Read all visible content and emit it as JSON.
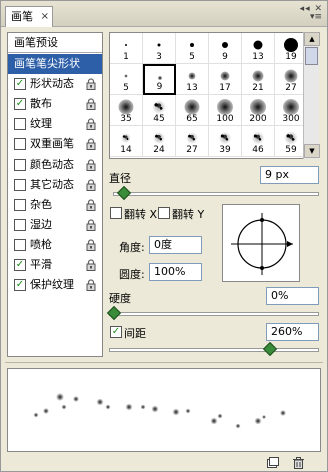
{
  "window": {
    "tab_title": "画笔",
    "tab_close": "×",
    "window_buttons": "◂◂ ✕",
    "menu_glyph": "▾≡"
  },
  "sidebar": {
    "header": "画笔预设",
    "items": [
      {
        "label": "画笔笔尖形状",
        "selected": true,
        "checkbox": false,
        "checked": false,
        "lock": false
      },
      {
        "label": "形状动态",
        "checkbox": true,
        "checked": true,
        "lock": true
      },
      {
        "label": "散布",
        "checkbox": true,
        "checked": true,
        "lock": true
      },
      {
        "label": "纹理",
        "checkbox": true,
        "checked": false,
        "lock": true
      },
      {
        "label": "双重画笔",
        "checkbox": true,
        "checked": false,
        "lock": true
      },
      {
        "label": "颜色动态",
        "checkbox": true,
        "checked": false,
        "lock": true
      },
      {
        "label": "其它动态",
        "checkbox": true,
        "checked": false,
        "lock": true
      },
      {
        "label": "杂色",
        "checkbox": true,
        "checked": false,
        "lock": true
      },
      {
        "label": "湿边",
        "checkbox": true,
        "checked": false,
        "lock": true
      },
      {
        "label": "喷枪",
        "checkbox": true,
        "checked": false,
        "lock": true
      },
      {
        "label": "平滑",
        "checkbox": true,
        "checked": true,
        "lock": true
      },
      {
        "label": "保护纹理",
        "checkbox": true,
        "checked": true,
        "lock": true
      }
    ],
    "check_glyph": "✓"
  },
  "brush_grid": {
    "cells": [
      {
        "size": "1",
        "kind": "hard",
        "dot": 2
      },
      {
        "size": "3",
        "kind": "hard",
        "dot": 3
      },
      {
        "size": "5",
        "kind": "hard",
        "dot": 4
      },
      {
        "size": "9",
        "kind": "hard",
        "dot": 6
      },
      {
        "size": "13",
        "kind": "hard",
        "dot": 9
      },
      {
        "size": "19",
        "kind": "hard",
        "dot": 14
      },
      {
        "size": "5",
        "kind": "soft",
        "dot": 3
      },
      {
        "size": "9",
        "kind": "soft",
        "dot": 4,
        "selected": true
      },
      {
        "size": "13",
        "kind": "soft",
        "dot": 7
      },
      {
        "size": "17",
        "kind": "soft",
        "dot": 9
      },
      {
        "size": "21",
        "kind": "soft",
        "dot": 11
      },
      {
        "size": "27",
        "kind": "soft",
        "dot": 13
      },
      {
        "size": "35",
        "kind": "soft",
        "dot": 15
      },
      {
        "size": "45",
        "kind": "spatter",
        "dot": 14
      },
      {
        "size": "65",
        "kind": "soft",
        "dot": 15
      },
      {
        "size": "100",
        "kind": "soft",
        "dot": 16
      },
      {
        "size": "200",
        "kind": "soft",
        "dot": 16
      },
      {
        "size": "300",
        "kind": "soft",
        "dot": 16
      },
      {
        "size": "14",
        "kind": "spatter",
        "dot": 10
      },
      {
        "size": "24",
        "kind": "spatter",
        "dot": 12
      },
      {
        "size": "27",
        "kind": "spatter",
        "dot": 12
      },
      {
        "size": "39",
        "kind": "spatter",
        "dot": 13
      },
      {
        "size": "46",
        "kind": "spatter",
        "dot": 13
      },
      {
        "size": "59",
        "kind": "spatter",
        "dot": 14
      }
    ],
    "scroll_up": "▲",
    "scroll_down": "▼"
  },
  "diameter": {
    "label": "直径",
    "value": "9 px",
    "slider_fraction": 0.03
  },
  "flip": {
    "flip_x_label": "翻转 X",
    "flip_y_label": "翻转 Y",
    "flip_x": false,
    "flip_y": false
  },
  "angle": {
    "label": "角度:",
    "value": "0度"
  },
  "roundness": {
    "label": "圆度:",
    "value": "100%"
  },
  "hardness": {
    "label": "硬度",
    "value": "0%",
    "slider_fraction": 0.0
  },
  "spacing": {
    "label": "间距",
    "checked": true,
    "value": "260%",
    "slider_fraction": 0.78
  }
}
